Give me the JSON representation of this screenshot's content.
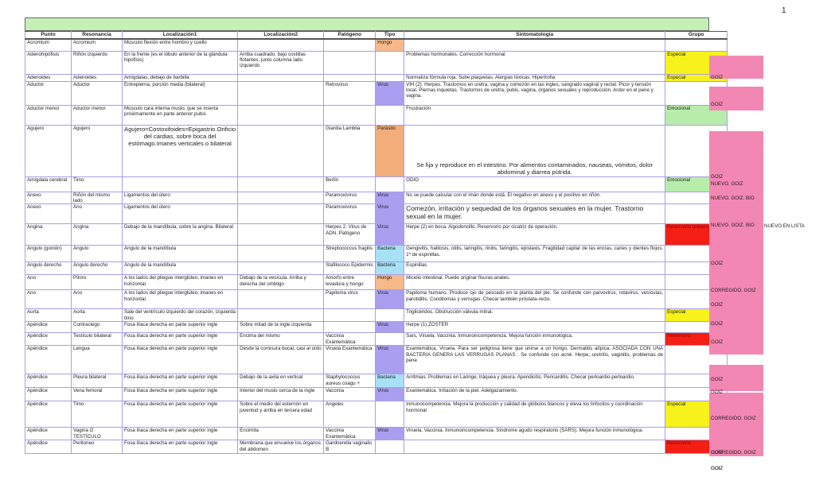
{
  "page_number": "1",
  "headers": [
    "Punto",
    "Resonancia",
    "Localización1",
    "Localización2",
    "Patógeno",
    "Tipo",
    "Sintomatología",
    "Grupo"
  ],
  "rows": [
    {
      "punto": "Acromium",
      "resonancia": "Acromium",
      "loc1": "Músculo flexión entre hombro y cuello",
      "loc2": "",
      "patogeno": "",
      "tipo": "Hongo",
      "sintomas": "",
      "grupo": "",
      "nota": ""
    },
    {
      "punto": "Adenohipófisis",
      "resonancia": "Riñón izquierdo",
      "loc1": "En la frente (es el lóbulo anterior de la glándula hipófisis)",
      "loc2": "Arriba cuadrado, bajo costillas flotantes, junto columna lado izquierdo",
      "patogeno": "",
      "tipo": "",
      "sintomas": "Problemas hormonales. Corrección hormonal",
      "grupo": "Especial",
      "nota": "GOIZ"
    },
    {
      "punto": "Adenoides",
      "resonancia": "Adenoides",
      "loc1": "Amígdalas, debajo de barbilla",
      "loc2": "",
      "patogeno": "",
      "tipo": "",
      "sintomas": "Normaliza fórmula roja. Sube plaquetas. Alergias tóxicas. Hipertrofia",
      "grupo": "Especial",
      "nota": ""
    },
    {
      "punto": "Aductor",
      "resonancia": "Aductor",
      "loc1": "Entrepierna, porción media (bilateral)",
      "loc2": "",
      "patogeno": "Retrovirus",
      "tipo": "Virus",
      "sintomas": "VIH (2). Herpes. Trastornos en uretra, vagina y comezón en las ingles, sangrado vaginal y rectal. Picor y tensión local. Piernas inquietas. Trastornos de uretra, pubis, vagina, órganos sexuales y reproducción. Ardor en el pene y vagina.",
      "grupo": "",
      "nota": "GOIZ"
    },
    {
      "punto": "Aductor menor",
      "resonancia": "Aductor menor",
      "loc1": "Músculo cara interna muslo, que se inserta próximamente en parte anterior pubis",
      "loc2": "",
      "patogeno": "",
      "tipo": "",
      "sintomas": "Frustración",
      "grupo": "Emocional",
      "nota": "GOIZ"
    },
    {
      "punto": "Agujero",
      "resonancia": "Agujero",
      "loc1": "Agujero=Costoxifoides=Epigastrio.Orificio del cardias, sobre boca del estómago.Imanes verticales o bilateral",
      "loc2": "",
      "patogeno": "Giardia Lamblia",
      "tipo": "Parásito",
      "sintomas": "Se fija y reproduce en el intestino. Por alimentos contaminados, nauseas, vómitos, dolor abdominal y diarrea pútrida.",
      "grupo": "",
      "nota": "NUEVO. GOIZ"
    },
    {
      "punto": "Amígdala cerebral",
      "resonancia": "Timo",
      "loc1": "",
      "loc2": "",
      "patogeno": "Berlín",
      "tipo": "",
      "sintomas": "ODIO",
      "grupo": "Emocional",
      "nota": "NUEVO. GOIZ. BIO"
    },
    {
      "punto": "Anexo",
      "resonancia": "Riñón del mismo lado",
      "loc1": "Ligamentos del útero",
      "loc2": "",
      "patogeno": "Paramoxivirus",
      "tipo": "Virus",
      "sintomas": "No se puede calcular con el imán donde está. El negativo en anexo y el positivo en riñón.",
      "grupo": "",
      "nota": "NUEVO. GOIZ. BIO"
    },
    {
      "punto": "Anexo",
      "resonancia": "Ano",
      "loc1": "Ligamentos del útero",
      "loc2": "",
      "patogeno": "Paramoxivirus",
      "tipo": "Virus",
      "sintomas": "Comezón, irritación y sequedad de los órganos sexuales en la mujer. Trastorno sexual en la mujer.",
      "grupo": "",
      "nota": "GOIZ"
    },
    {
      "punto": "Angina",
      "resonancia": "Angina",
      "loc1": "Debajo de la mandíbula, sobre la angina. Bilateral",
      "loc2": "",
      "patogeno": "Herpes 2. Virus de ADN. Patógeno",
      "tipo": "Virus",
      "sintomas": "Herpe (2) en boca. Algodoncillo. Reservorio por cicatriz de operación.",
      "grupo": "Reservorio universal",
      "nota": "CORREGIDO. GOIZ"
    },
    {
      "punto": "Ángulo (gonión)",
      "resonancia": "Ángulo",
      "loc1": "Angulo de la mandíbula",
      "loc2": "",
      "patogeno": "Streptococcus fragilis",
      "tipo": "Bacteria",
      "sintomas": "Gengivitis, halitosis, otitis, laringitis, rinitis, faringitis, epistaxis. Fragilidad capilar de las encías, caries y dientes flojos. 1º de espinillas.",
      "grupo": "",
      "nota": "GOIZ"
    },
    {
      "punto": "Ángulo derecho",
      "resonancia": "Ángulo derecho",
      "loc1": "Angulo de la mandíbula",
      "loc2": "",
      "patogeno": "Stafilococo Epidermis",
      "tipo": "Bacteria",
      "sintomas": "Espinillas",
      "grupo": "",
      "nota": ""
    },
    {
      "punto": "Ano",
      "resonancia": "Píloro",
      "loc1": "A los lados del pliegue interglúteo, imanes en horizontal.",
      "loc2": "Debajo de la vesícula. Arriba y derecha del ombligo",
      "patogeno": "Amorfo entre levadura y hongo",
      "tipo": "Hongo",
      "sintomas": "Micelio intestinal. Puede originar fisuras anales.",
      "grupo": "",
      "nota": "GOIZ"
    },
    {
      "punto": "Ano",
      "resonancia": "Ano",
      "loc1": "A los lados del pliegue interglúteo, imanes en horizontal.",
      "loc2": "",
      "patogeno": "Papiloma virus",
      "tipo": "Virus",
      "sintomas": "Papiloma humano. Produce ojo de pescado en la planta del pie. Se confunde con parvovirus, rotavirus, vesículas, parotiditis. Condilomas y verrugas. Checar también próstata-recto.",
      "grupo": "",
      "nota": "GOIZ"
    },
    {
      "punto": "Aorta",
      "resonancia": "Aorta",
      "loc1": "Sale del ventrículo izquierdo del corazón, izquierda timo",
      "loc2": "",
      "patogeno": "",
      "tipo": "",
      "sintomas": "Triglicéridos. Obstrucción válvula mitral.",
      "grupo": "Especial",
      "nota": "GOIZ"
    },
    {
      "punto": "Apéndice",
      "resonancia": "Contraciego",
      "loc1": "Fosa ilíaca derecha en parte superior ingle",
      "loc2": "Sobre mitad de la ingle izquierda",
      "patogeno": "",
      "tipo": "Virus",
      "sintomas": "Herpe (1) ZOSTER",
      "grupo": "",
      "nota": "GOIZ"
    },
    {
      "punto": "Apéndice",
      "resonancia": "Testículo bilateral",
      "loc1": "Fosa ilíaca derecha en parte superior ingle",
      "loc2": "Encima del mismo",
      "patogeno": "Vaccinia Exantemática",
      "tipo": "",
      "sintomas": "Sars, Viruela, Vaccinia.   Inmunoincompetencia.          Mejora función inmunológica.",
      "grupo": "Reservorio",
      "nota": ""
    },
    {
      "punto": "Apéndice",
      "resonancia": "Lengua",
      "loc1": "Fosa ilíaca derecha en parte superior ingle",
      "loc2": "Desde la comisura bucal, casi al oído",
      "patogeno": "Viruela Exantemática",
      "tipo": "Virus",
      "sintomas": "Exantemática. Viruela. Para ser peligrosa tiene que unirse a un hongo. Dermatitis atípica, ASOCIADA CON UNA BACTERIA GENERA LAS VERRUGAS PLANAS . Se confunde con acné. Herpe, uretritis, vaginitis, problemas de pene",
      "grupo": "",
      "nota": "CORREGIDO. GOIZ"
    },
    {
      "punto": "Apéndice",
      "resonancia": "Pleura bilateral",
      "loc1": "Fosa ilíaca derecha en parte superior ingle",
      "loc2": "Debajo de la axila en vertical",
      "patogeno": "Staphylococcus aureus coagu +",
      "tipo": "Bacteria",
      "sintomas": "Arritmias. Problemas en Laringe, tráquea y pleura. Apendicitis. Pericarditis. Checar perloardio-perloardio.",
      "grupo": "",
      "nota": "CORREGIDO. GOIZ"
    },
    {
      "punto": "Apéndice",
      "resonancia": "Vena femoral",
      "loc1": "Fosa ilíaca derecha en parte superior ingle",
      "loc2": "Interior del muslo cerca de la ingle",
      "patogeno": "Vaccinia",
      "tipo": "Virus",
      "sintomas": "Exantemática. Irritación de la piel. Adelgazamiento.",
      "grupo": "",
      "nota": "GOIZ"
    },
    {
      "punto": "Apéndice",
      "resonancia": "Timo",
      "loc1": "Fosa ilíaca derecha en parte superior ingle",
      "loc2": "Sobre el medio del esternón en juventud y arriba en tercera edad",
      "patogeno": "Angeles",
      "tipo": "",
      "sintomas": "Inmunocompetencia. Mejora la producción y calidad de glóbulos blancos y eleva los linfocitos y coordinación hormonal",
      "grupo": "Especial",
      "nota": "GOIZ"
    },
    {
      "punto": "Apéndice",
      "resonancia": "Vagina O TESTÍCULO",
      "loc1": "Fosa ilíaca derecha en parte superior ingle",
      "loc2": "Encimita",
      "patogeno": "Vaccinia Exantemática",
      "tipo": "Virus",
      "sintomas": "Viruela, Vaccinia. Inmunoincompetencia. Síndrome agudo respiratorio (SARS). Mejora función inmunológica.",
      "grupo": "",
      "nota": "GOIZ"
    },
    {
      "punto": "Apéndice",
      "resonancia": "Peritoneo",
      "loc1": "Fosa ilíaca derecha en parte superior ingle",
      "loc2": "Membrana que envuelve los órganos del abdomen",
      "patogeno": "Gardnerella vaginalis B",
      "tipo": "",
      "sintomas": "",
      "grupo": "Reservorio",
      "nota": ""
    }
  ],
  "side_labels": [
    {
      "text": "GOIZ"
    },
    {
      "text": "GOIZ"
    },
    {
      "text": "GOIZ"
    },
    {
      "text": "NUEVO. GOIZ"
    },
    {
      "text": "NUEVO. GOIZ. BIO"
    },
    {
      "text": "NUEVO. GOIZ. BIO"
    },
    {
      "text": "GOIZ"
    },
    {
      "text": "CORREGIDO. GOIZ"
    },
    {
      "text": "GOIZ"
    },
    {
      "text": "GOIZ"
    },
    {
      "text": "GOIZ"
    },
    {
      "text": "GOIZ"
    },
    {
      "text": "GOIZ"
    },
    {
      "text": "CORREGIDO. GOIZ"
    },
    {
      "text": "CORREGIDO. GOIZ"
    },
    {
      "text": "GOIZ"
    },
    {
      "text": "GOIZ"
    },
    {
      "text": "GOIZ"
    }
  ],
  "extra_note": "NUEVO EN LISTA",
  "colors": {
    "Hongo": "#f6b98a",
    "Virus": "#aa9ef0",
    "Parásito": "#f2ad7a",
    "Bacteria": "#a8e1f5",
    "Especial": "#f7f21b",
    "Emocional": "#b8ecaa",
    "Reservorio": "#f51e14",
    "header_band": "#c6efb6",
    "side_band": "#f387b4",
    "grid": "#a99ee6"
  }
}
